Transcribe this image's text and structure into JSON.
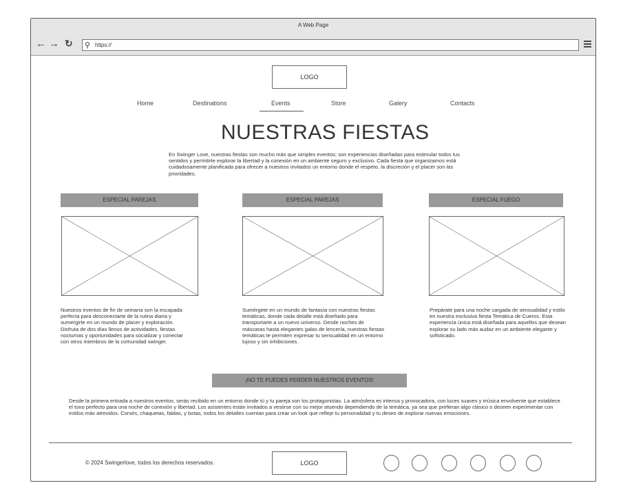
{
  "browser": {
    "title": "A Web Page",
    "url": "https://",
    "back_icon": "arrow-left-icon",
    "forward_icon": "arrow-right-icon",
    "refresh_icon": "refresh-icon"
  },
  "header": {
    "logo": "LOGO"
  },
  "nav": {
    "items": [
      "Home",
      "Destinations",
      "Events",
      "Store",
      "Galery",
      "Contacts"
    ],
    "active": "Events"
  },
  "hero": {
    "title": "NUESTRAS FIESTAS",
    "intro": "En Swinger Love, nuestras fiestas son mucho más que simples eventos; son experiencias diseñadas para estimular todos tus sentidos y permitirte explorar la libertad y la conexión en un ambiente seguro y exclusivo. Cada fiesta que organizamos está cuidadosamente planificada para ofrecer a nuestros invitados un entorno donde el respeto, la discreción y el placer son las prioridades."
  },
  "cards": [
    {
      "label": "ESPECIAL PAREJAS",
      "text": "Nuestros eventos de fin de semana son la escapada perfecta para desconectarte de la rutina diaria y sumergirte en un mundo de placer y exploración. Disfruta de dos días llenos de actividades, fiestas nocturnas y oportunidades para socializar y conectar con otros miembros de la comunidad swinger."
    },
    {
      "label": "ESPECIAL PAREJAS",
      "text": "Sumérgete en un mundo de fantasía con nuestras fiestas temáticas, donde cada detalle está diseñado para transportarte a un nuevo universo. Desde noches de máscaras hasta elegantes galas de lencería, nuestras fiestas temáticas te permiten expresar tu sensualidad en un entorno lujoso y sin inhibiciones."
    },
    {
      "label": "ESPECIAL FUEGO",
      "text": "Prepárate para una noche cargada de sensualidad y estilo en nuestra exclusiva fiesta Temática de Cueros. Esta experiencia única está diseñada para aquellos que desean explorar su lado más audaz en un ambiente elegante y sofisticado."
    }
  ],
  "cta": {
    "label": "¡NO TE PUEDES PERDER NUESTROS EVENTOS!",
    "text": "Desde la primera entrada a nuestros eventos, serás recibido en un entorno donde tú y tu pareja son los protagonistas. La atmósfera es intensa y provocadora, con luces suaves y música envolvente que establece el tono perfecto para una noche de conexión y libertad. Los asistentes están invitados a vestirse con su mejor atuendo dependiendo de la temática, ya sea que prefieran algo clásico o deseen experimentar con estilos más atrevidos. Corsés, chaquetas, faldas, y botas, todos los detalles cuentan para crear un look que refleje tu personalidad y tu deseo de explorar nuevas emociones."
  },
  "footer": {
    "copyright": "© 2024 Swingerlove, todos los derechos reservados.",
    "logo": "LOGO",
    "social_icons": [
      "social-icon-1",
      "social-icon-2",
      "social-icon-3",
      "social-icon-4",
      "social-icon-5",
      "social-icon-6"
    ]
  }
}
